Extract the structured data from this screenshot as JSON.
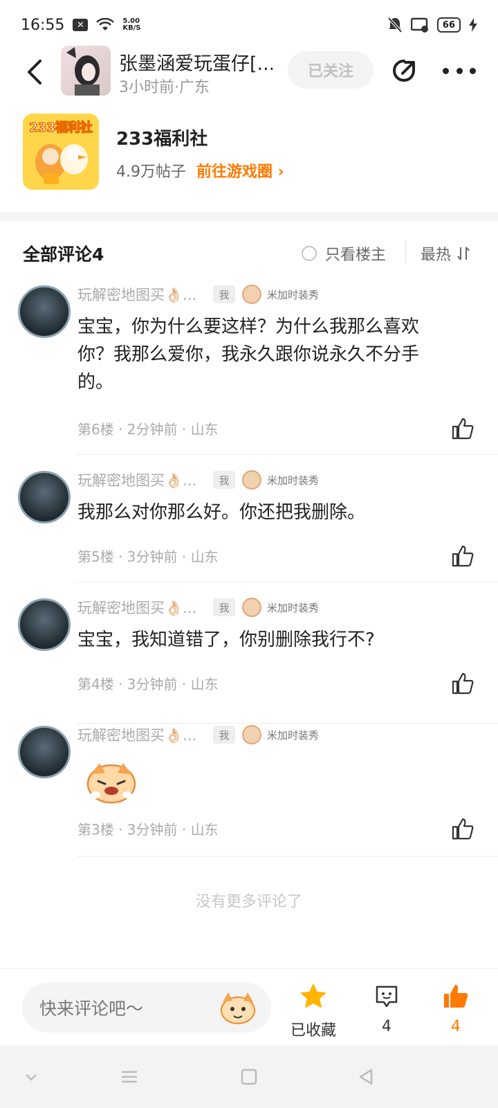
{
  "status_bar": {
    "time": "16:55",
    "net_speed_value": "5.00",
    "net_speed_unit": "KB/S",
    "battery": "66"
  },
  "header": {
    "author_name": "张墨涵爱玩蛋仔[...",
    "author_meta": "3小时前·广东",
    "follow_label": "已关注"
  },
  "circle": {
    "icon_text": "233福利社",
    "name": "233福利社",
    "post_count": "4.9万帖子",
    "link_label": "前往游戏圈"
  },
  "comments_header": {
    "title": "全部评论4",
    "only_op_label": "只看楼主",
    "sort_label": "最热"
  },
  "comments": [
    {
      "name": "玩解密地图买👌🏻...",
      "me_badge": "我",
      "deco_label": "米加时装秀",
      "text": "宝宝，你为什么要这样？为什么我那么喜欢你？我那么爱你，我永久跟你说永久不分手的。",
      "meta": "第6楼 · 2分钟前 · 山东"
    },
    {
      "name": "玩解密地图买👌🏻...",
      "me_badge": "我",
      "deco_label": "米加时装秀",
      "text": "我那么对你那么好。你还把我删除。",
      "meta": "第5楼 · 3分钟前 · 山东"
    },
    {
      "name": "玩解密地图买👌🏻...",
      "me_badge": "我",
      "deco_label": "米加时装秀",
      "text": "宝宝，我知道错了，你别删除我行不?",
      "meta": "第4楼 · 3分钟前 · 山东"
    },
    {
      "name": "玩解密地图买👌🏻...",
      "me_badge": "我",
      "deco_label": "米加时装秀",
      "text": "",
      "meta": "第3楼 · 3分钟前 · 山东"
    }
  ],
  "no_more_text": "没有更多评论了",
  "bottom_bar": {
    "input_placeholder": "快来评论吧～",
    "favorite_label": "已收藏",
    "comment_count": "4",
    "like_count": "4"
  },
  "colors": {
    "accent_orange": "#ff7a00",
    "star_yellow": "#ffb400"
  }
}
